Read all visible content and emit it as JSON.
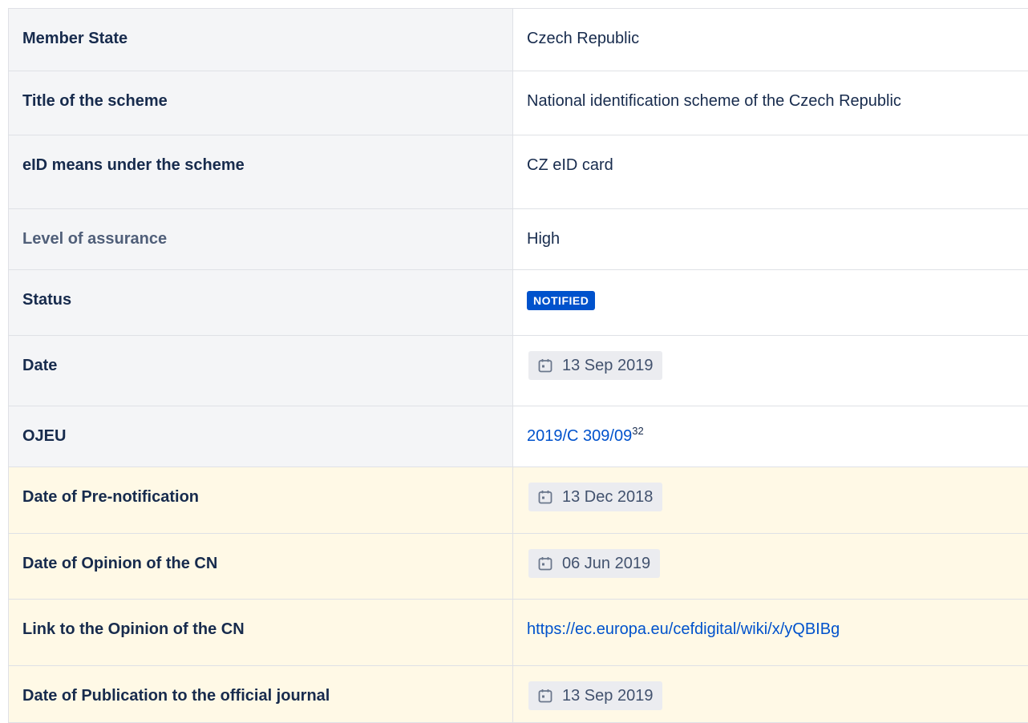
{
  "rows": [
    {
      "label": "Member State",
      "value": "Czech Republic"
    },
    {
      "label": "Title of the scheme",
      "value": "National identification scheme of the Czech Republic"
    },
    {
      "label": "eID means under the scheme",
      "value": "CZ eID card"
    },
    {
      "label": "Level of assurance",
      "value": "High"
    },
    {
      "label": "Status",
      "value": "NOTIFIED"
    },
    {
      "label": "Date",
      "value": "13 Sep 2019"
    },
    {
      "label": "OJEU",
      "value": "2019/C 309/09",
      "footnote": "32"
    },
    {
      "label": "Date of Pre-notification",
      "value": "13 Dec 2018"
    },
    {
      "label": "Date of Opinion of the CN",
      "value": "06 Jun 2019"
    },
    {
      "label": "Link to the Opinion of the CN",
      "value": "https://ec.europa.eu/cefdigital/wiki/x/yQBIBg"
    },
    {
      "label": "Date of Publication to the official journal",
      "value": "13 Sep 2019"
    }
  ],
  "colors": {
    "header_bg": "#f4f5f7",
    "highlight_bg": "#fff9e6",
    "badge_bg": "#0052cc",
    "link": "#0052cc",
    "border": "#dfe1e6"
  },
  "icons": {
    "date": "calendar-icon"
  }
}
